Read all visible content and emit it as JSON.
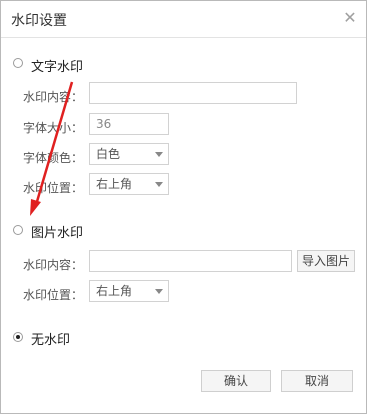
{
  "dialog": {
    "title": "水印设置",
    "close_icon": "close-icon"
  },
  "text_watermark": {
    "label": "文字水印",
    "selected": false,
    "content_label": "水印内容：",
    "content_value": "",
    "font_size_label": "字体大小：",
    "font_size_value": "36",
    "font_color_label": "字体颜色：",
    "font_color_value": "白色",
    "position_label": "水印位置：",
    "position_value": "右上角"
  },
  "image_watermark": {
    "label": "图片水印",
    "selected": false,
    "content_label": "水印内容：",
    "content_value": "",
    "import_button": "导入图片",
    "position_label": "水印位置：",
    "position_value": "右上角"
  },
  "no_watermark": {
    "label": "无水印",
    "selected": true
  },
  "footer": {
    "confirm": "确认",
    "cancel": "取消"
  },
  "colors": {
    "annotation_arrow": "#e02020"
  }
}
